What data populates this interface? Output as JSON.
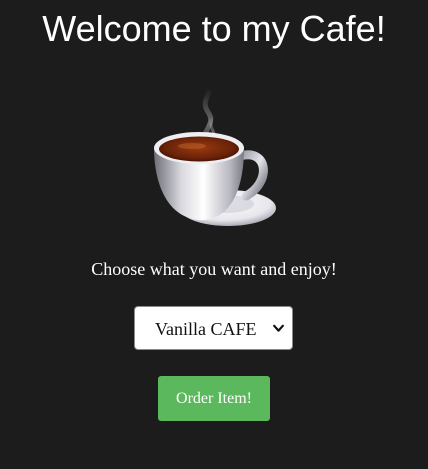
{
  "header": {
    "title": "Welcome to my Cafe!"
  },
  "hero": {
    "icon": "coffee-cup-icon"
  },
  "main": {
    "prompt": "Choose what you want and enjoy!",
    "menu_select": {
      "selected": "Vanilla CAFE",
      "icon": "chevron-down-icon"
    },
    "order_button_label": "Order Item!"
  },
  "colors": {
    "background": "#1c1c1c",
    "text": "#ffffff",
    "button": "#5cb85c",
    "select_background": "#ffffff"
  }
}
